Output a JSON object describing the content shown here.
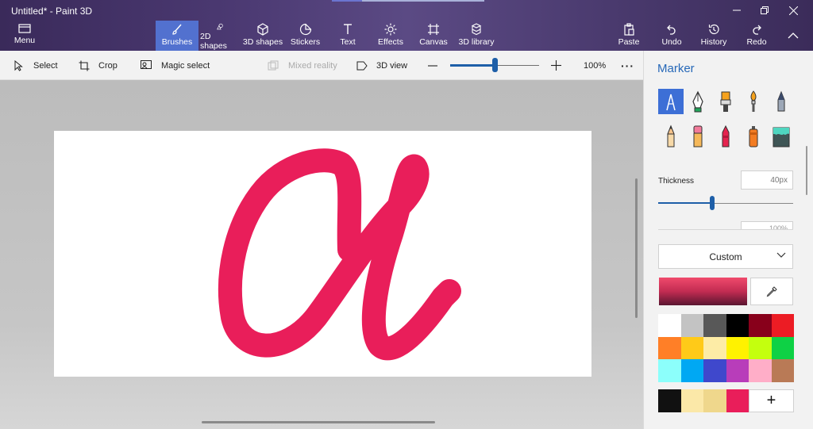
{
  "window": {
    "title": "Untitled* - Paint 3D"
  },
  "ribbon": {
    "menu": "Menu",
    "tools": [
      {
        "label": "Brushes",
        "icon": "brush-icon"
      },
      {
        "label": "2D shapes",
        "icon": "2d-shapes-icon"
      },
      {
        "label": "3D shapes",
        "icon": "3d-shapes-icon"
      },
      {
        "label": "Stickers",
        "icon": "stickers-icon"
      },
      {
        "label": "Text",
        "icon": "text-icon"
      },
      {
        "label": "Effects",
        "icon": "effects-icon"
      },
      {
        "label": "Canvas",
        "icon": "canvas-icon"
      },
      {
        "label": "3D library",
        "icon": "3d-library-icon"
      }
    ],
    "actions": [
      {
        "label": "Paste",
        "icon": "paste-icon"
      },
      {
        "label": "Undo",
        "icon": "undo-icon"
      },
      {
        "label": "History",
        "icon": "history-icon"
      },
      {
        "label": "Redo",
        "icon": "redo-icon"
      }
    ]
  },
  "toolbar": {
    "select": "Select",
    "crop": "Crop",
    "magic_select": "Magic select",
    "mixed_reality": "Mixed reality",
    "view_3d": "3D view",
    "zoom": "100%",
    "zoom_level": 0.5,
    "more": "···"
  },
  "panel": {
    "title": "Marker",
    "thickness_label": "Thickness",
    "thickness_value": "40px",
    "thickness_level": 0.4,
    "opacity_value": "100%",
    "texture": "Custom",
    "current_color": "#e91e5a",
    "swatches": [
      "#ffffff",
      "#c3c3c3",
      "#585858",
      "#000000",
      "#88001b",
      "#ec1c24",
      "#ff7f27",
      "#ffca18",
      "#fdeca6",
      "#fff200",
      "#c4ff0e",
      "#0ed145",
      "#8cfffb",
      "#00a8f3",
      "#3f48cc",
      "#b83dba",
      "#ffaec8",
      "#b97a56"
    ],
    "custom_colors": [
      "#111111",
      "#fbe8a8",
      "#efd78c",
      "#e91e5a"
    ],
    "add_label": "+"
  }
}
